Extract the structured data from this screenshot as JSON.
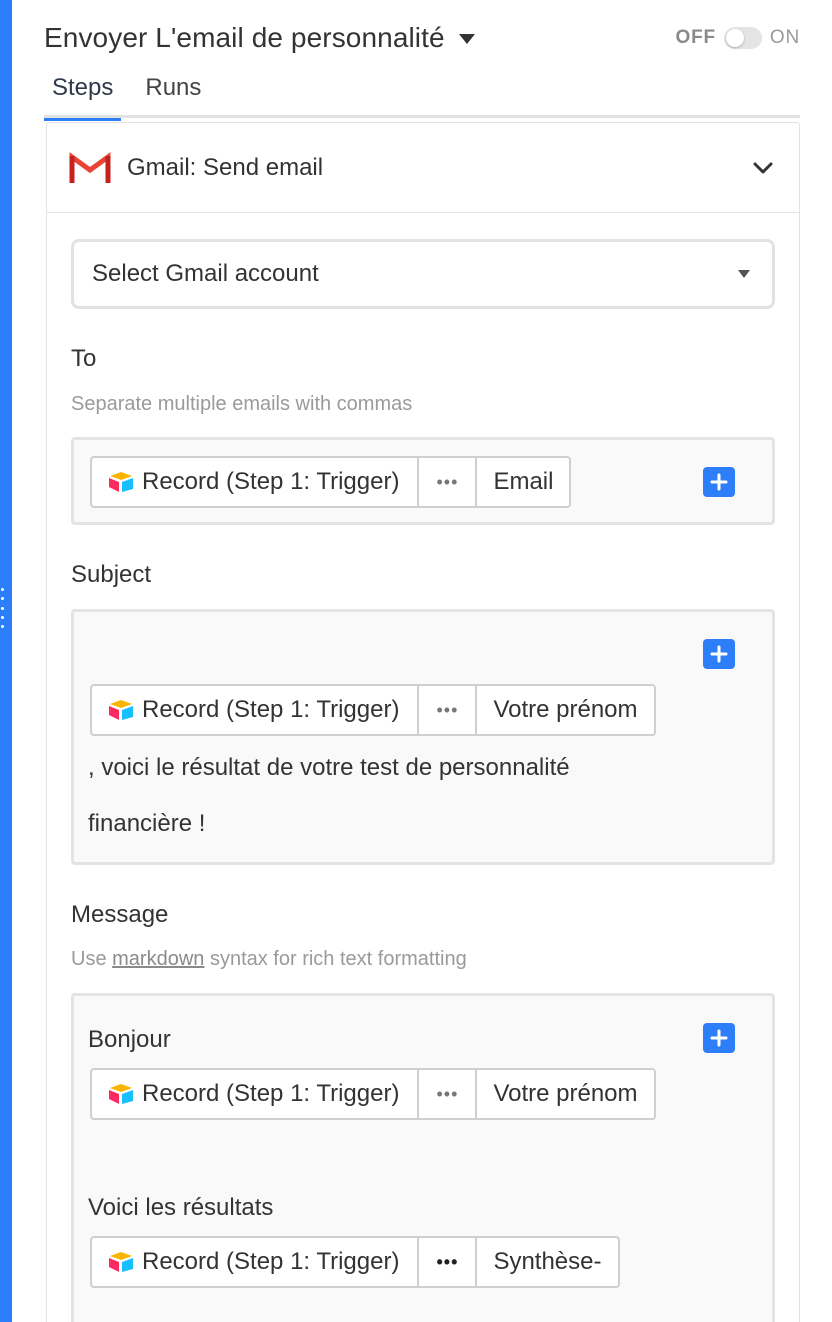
{
  "header": {
    "title": "Envoyer L'email de personnalité",
    "toggle_off": "OFF",
    "toggle_on": "ON"
  },
  "tabs": [
    {
      "label": "Steps",
      "active": true
    },
    {
      "label": "Runs",
      "active": false
    }
  ],
  "step": {
    "title": "Gmail: Send email",
    "icon": "gmail-icon"
  },
  "account_select": {
    "value": "Select Gmail account"
  },
  "token_source": "Record (Step 1: Trigger)",
  "token_dots": "•••",
  "to": {
    "label": "To",
    "hint": "Separate multiple emails with commas",
    "token_field": "Email"
  },
  "subject": {
    "label": "Subject",
    "token_field": "Votre prénom",
    "text_line1": ", voici le résultat de votre test de personnalité",
    "text_line2": "financière !"
  },
  "message": {
    "label": "Message",
    "hint_prefix": "Use ",
    "hint_link": "markdown",
    "hint_suffix": " syntax for rich text formatting",
    "greeting": "Bonjour",
    "token1_field": "Votre prénom",
    "results_text": "Voici les résultats",
    "token2_field": "Synthèse-"
  },
  "colors": {
    "accent": "#2d7ff9",
    "gmail_red": "#ea4335"
  }
}
